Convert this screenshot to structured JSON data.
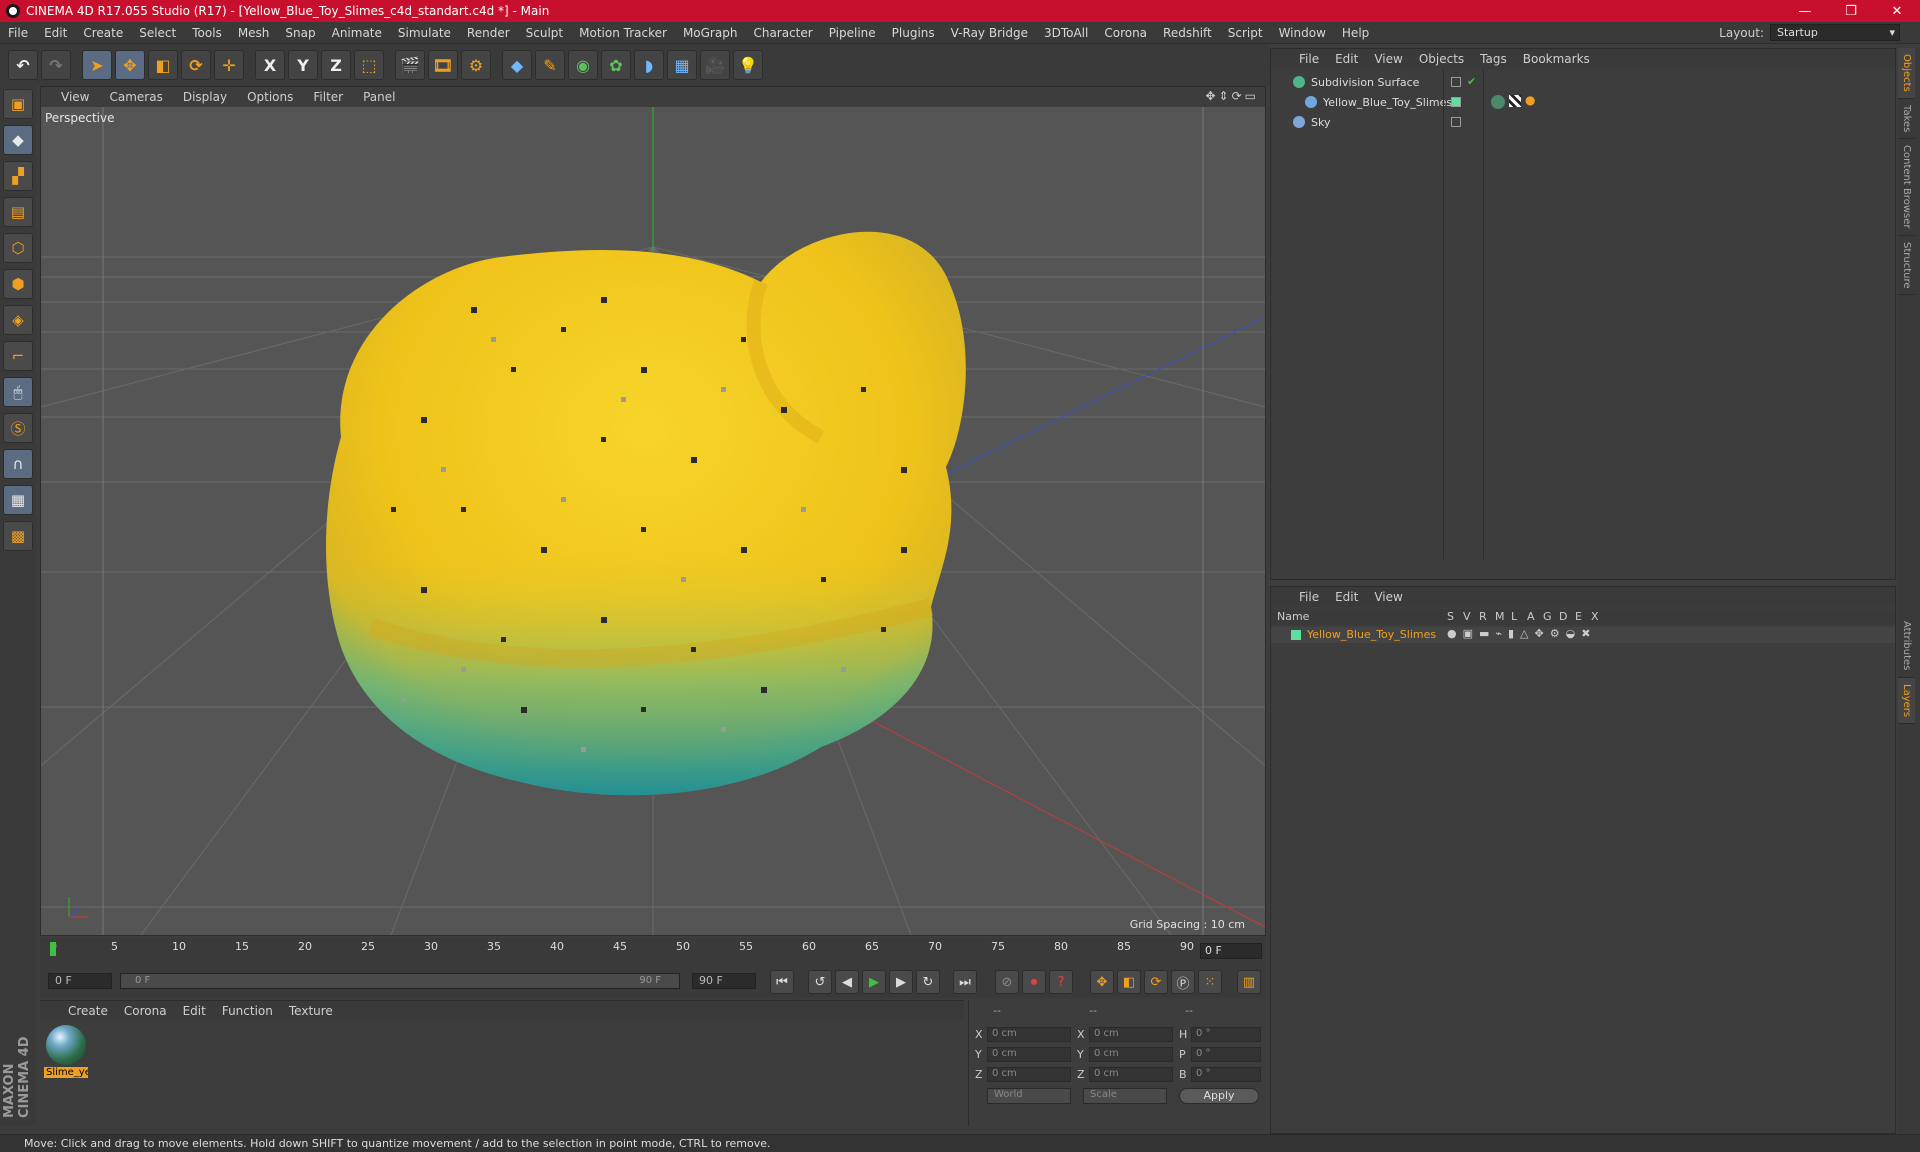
{
  "titlebar": {
    "title": "CINEMA 4D R17.055 Studio (R17) - [Yellow_Blue_Toy_Slimes_c4d_standart.c4d *] - Main",
    "minimize": "—",
    "maximize": "❐",
    "close": "✕"
  },
  "menubar": {
    "items": [
      "File",
      "Edit",
      "Create",
      "Select",
      "Tools",
      "Mesh",
      "Snap",
      "Animate",
      "Simulate",
      "Render",
      "Sculpt",
      "Motion Tracker",
      "MoGraph",
      "Character",
      "Pipeline",
      "Plugins",
      "V-Ray Bridge",
      "3DToAll",
      "Corona",
      "Redshift",
      "Script",
      "Window",
      "Help"
    ],
    "layout_label": "Layout:",
    "layout_value": "Startup"
  },
  "toolbar": {
    "icons": [
      "undo-icon",
      "redo-icon",
      "select-arrow-icon",
      "move-icon",
      "scale-icon",
      "rotate-icon",
      "move-cursor-icon",
      "x-axis-icon",
      "y-axis-icon",
      "z-axis-icon",
      "coord-system-icon",
      "render-view-icon",
      "render-picture-viewer-icon",
      "render-settings-icon",
      "cube-icon",
      "pen-icon",
      "subdivision-icon",
      "array-icon",
      "deformer-icon",
      "floor-icon",
      "camera-icon",
      "light-icon"
    ],
    "axis_x": "X",
    "axis_y": "Y",
    "axis_z": "Z"
  },
  "viewport": {
    "menu": [
      "View",
      "Cameras",
      "Display",
      "Options",
      "Filter",
      "Panel"
    ],
    "label": "Perspective",
    "grid_spacing": "Grid Spacing : 10 cm"
  },
  "timeline": {
    "ticks": [
      "0",
      "5",
      "10",
      "15",
      "20",
      "25",
      "30",
      "35",
      "40",
      "45",
      "50",
      "55",
      "60",
      "65",
      "70",
      "75",
      "80",
      "85",
      "90"
    ],
    "current_frame": "0 F"
  },
  "transport": {
    "start_field": "0 F",
    "range_start": "0 F",
    "range_end": "90 F",
    "end_field": "90 F"
  },
  "material_panel": {
    "menu": [
      "Create",
      "Corona",
      "Edit",
      "Function",
      "Texture"
    ],
    "material_label": "Slime_ye"
  },
  "coord_panel": {
    "headers": [
      "--",
      "--",
      "--"
    ],
    "rows": [
      {
        "l1": "X",
        "v1": "0 cm",
        "l2": "X",
        "v2": "0 cm",
        "l3": "H",
        "v3": "0 °"
      },
      {
        "l1": "Y",
        "v1": "0 cm",
        "l2": "Y",
        "v2": "0 cm",
        "l3": "P",
        "v3": "0 °"
      },
      {
        "l1": "Z",
        "v1": "0 cm",
        "l2": "Z",
        "v2": "0 cm",
        "l3": "B",
        "v3": "0 °"
      }
    ],
    "world_select": "World",
    "scale_select": "Scale",
    "apply": "Apply"
  },
  "objects_panel": {
    "menu": [
      "File",
      "Edit",
      "View",
      "Objects",
      "Tags",
      "Bookmarks"
    ],
    "objects": [
      {
        "name": "Subdivision Surface",
        "color": "#4fb38c"
      },
      {
        "name": "Yellow_Blue_Toy_Slimes",
        "color": "#6fa7e0"
      },
      {
        "name": "Sky",
        "color": "#7fa6d6"
      }
    ]
  },
  "layers_panel": {
    "menu": [
      "File",
      "Edit",
      "View"
    ],
    "columns": [
      "Name",
      "S",
      "V",
      "R",
      "M",
      "L",
      "A",
      "G",
      "D",
      "E",
      "X"
    ],
    "layer_name": "Yellow_Blue_Toy_Slimes"
  },
  "side_tabs": [
    "Objects",
    "Takes",
    "Content Browser",
    "Structure",
    "Attributes",
    "Layers"
  ],
  "status": "Move: Click and drag to move elements. Hold down SHIFT to quantize movement / add to the selection in point mode, CTRL to remove.",
  "brand": "MAXON CINEMA 4D",
  "colors": {
    "accent": "#f0a020",
    "title_bar": "#c8102e",
    "slime_yellow": "#f2c91a",
    "slime_teal": "#2aa39a"
  }
}
